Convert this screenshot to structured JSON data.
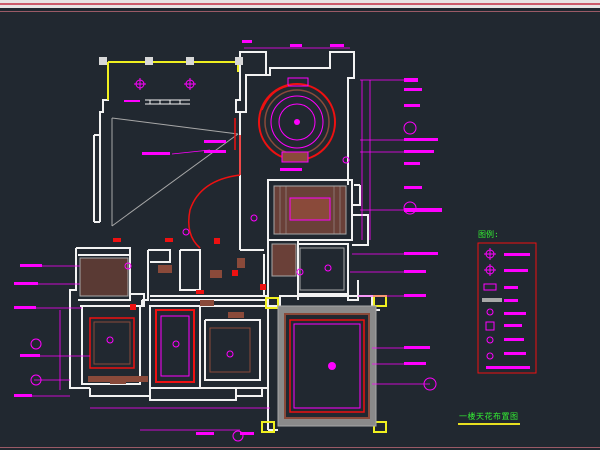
{
  "drawing": {
    "title": "一楼天花布置图",
    "legend_title": "图例:"
  },
  "colors": {
    "background": "#212830",
    "wall": "#f2f2f2",
    "annotation": "#ff00ff",
    "red": "#ee1111",
    "yellow": "#f0f020",
    "green": "#33ee33",
    "brown": "#8a4a3a",
    "gray": "#a8a8a8"
  }
}
